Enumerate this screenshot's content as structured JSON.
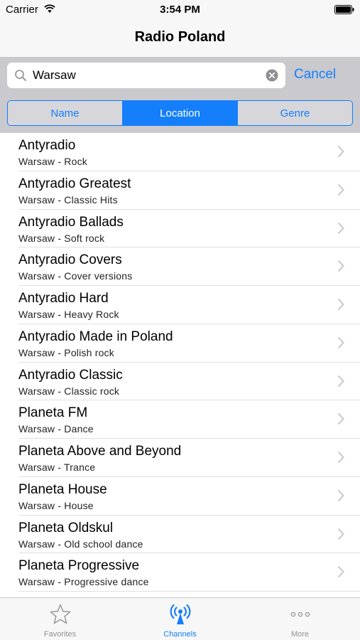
{
  "status_bar": {
    "carrier": "Carrier",
    "time": "3:54 PM"
  },
  "nav": {
    "title": "Radio Poland"
  },
  "search": {
    "value": "Warsaw",
    "cancel_label": "Cancel"
  },
  "scope": {
    "segments": [
      {
        "label": "Name",
        "selected": false
      },
      {
        "label": "Location",
        "selected": true
      },
      {
        "label": "Genre",
        "selected": false
      }
    ]
  },
  "stations": [
    {
      "title": "Antyradio",
      "subtitle": "Warsaw - Rock"
    },
    {
      "title": "Antyradio Greatest",
      "subtitle": "Warsaw - Classic Hits"
    },
    {
      "title": "Antyradio Ballads",
      "subtitle": "Warsaw - Soft rock"
    },
    {
      "title": "Antyradio Covers",
      "subtitle": "Warsaw - Cover versions"
    },
    {
      "title": "Antyradio Hard",
      "subtitle": "Warsaw - Heavy Rock"
    },
    {
      "title": "Antyradio Made in Poland",
      "subtitle": "Warsaw - Polish rock"
    },
    {
      "title": "Antyradio Classic",
      "subtitle": "Warsaw - Classic rock"
    },
    {
      "title": "Planeta FM",
      "subtitle": "Warsaw - Dance"
    },
    {
      "title": "Planeta Above and Beyond",
      "subtitle": "Warsaw - Trance"
    },
    {
      "title": "Planeta House",
      "subtitle": "Warsaw - House"
    },
    {
      "title": "Planeta Oldskul",
      "subtitle": "Warsaw - Old school dance"
    },
    {
      "title": "Planeta Progressive",
      "subtitle": "Warsaw - Progressive dance"
    }
  ],
  "tabs": [
    {
      "label": "Favorites",
      "icon": "star-icon",
      "active": false
    },
    {
      "label": "Channels",
      "icon": "radio-tower-icon",
      "active": true
    },
    {
      "label": "More",
      "icon": "more-icon",
      "active": false
    }
  ],
  "colors": {
    "accent": "#147efb",
    "search_bg": "#c9c9ce",
    "inactive_tab": "#929292"
  }
}
